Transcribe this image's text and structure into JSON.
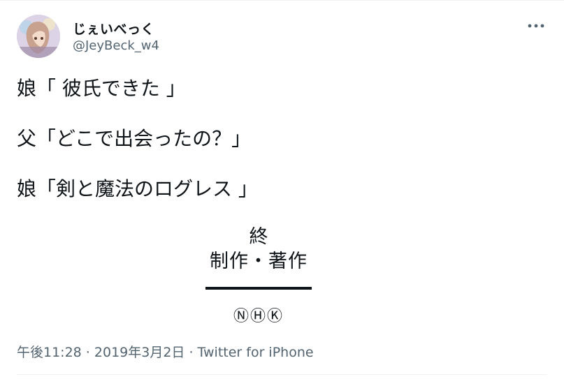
{
  "user": {
    "display_name": "じぇいべっく",
    "handle": "@JeyBeck_w4"
  },
  "tweet": {
    "lines": [
      "娘「 彼氏できた 」",
      "父「どこで出会ったの？」",
      "娘「剣と魔法のログレス 」"
    ],
    "credits": {
      "end": "終",
      "production": "制作・著作",
      "logo": "ⓃⒽⓀ"
    }
  },
  "meta": {
    "time": "午後11:28",
    "separator1": " · ",
    "date": "2019年3月2日",
    "separator2": " · ",
    "source": "Twitter for iPhone"
  },
  "icons": {
    "more": "more-horizontal-icon"
  }
}
